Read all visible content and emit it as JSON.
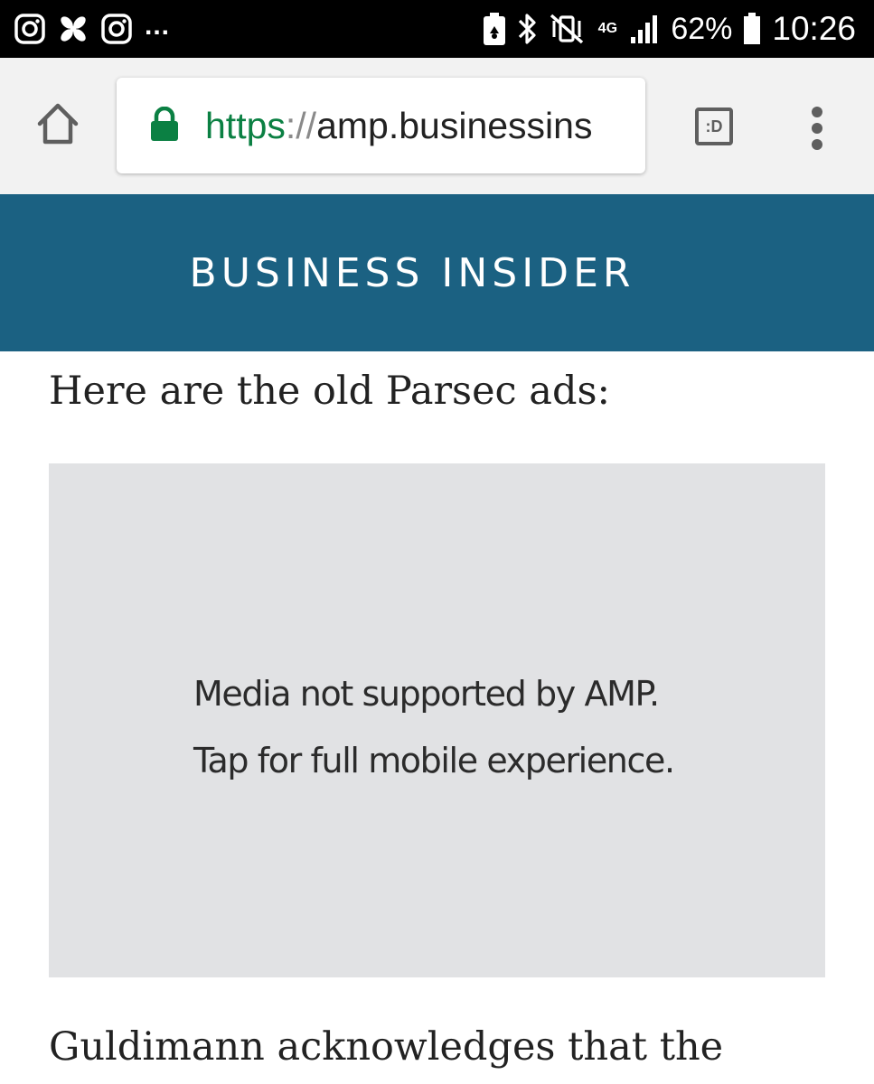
{
  "status_bar": {
    "left_icons": [
      "instagram-icon",
      "pinwheel-icon",
      "instagram-icon"
    ],
    "overflow": "...",
    "right_icons": [
      "battery-saver-icon",
      "bluetooth-icon",
      "vibrate-icon",
      "network-4g-icon",
      "signal-icon",
      "battery-icon"
    ],
    "network_label": "4G",
    "battery_percent": "62%",
    "time": "10:26"
  },
  "browser": {
    "url_scheme": "https",
    "url_separator": "://",
    "url_host": "amp.businessins",
    "tabs_label": ":D",
    "scheme_color": "#0b8043",
    "lock_color": "#0b8043"
  },
  "site": {
    "logo_text": "BUSINESS INSIDER",
    "header_color": "#1b6182"
  },
  "article": {
    "intro": "Here are the old Parsec ads:",
    "media_placeholder": {
      "line1": "Media not supported by AMP.",
      "line2": "Tap for full mobile experience."
    },
    "next_paragraph": "Guldimann acknowledges that the"
  }
}
